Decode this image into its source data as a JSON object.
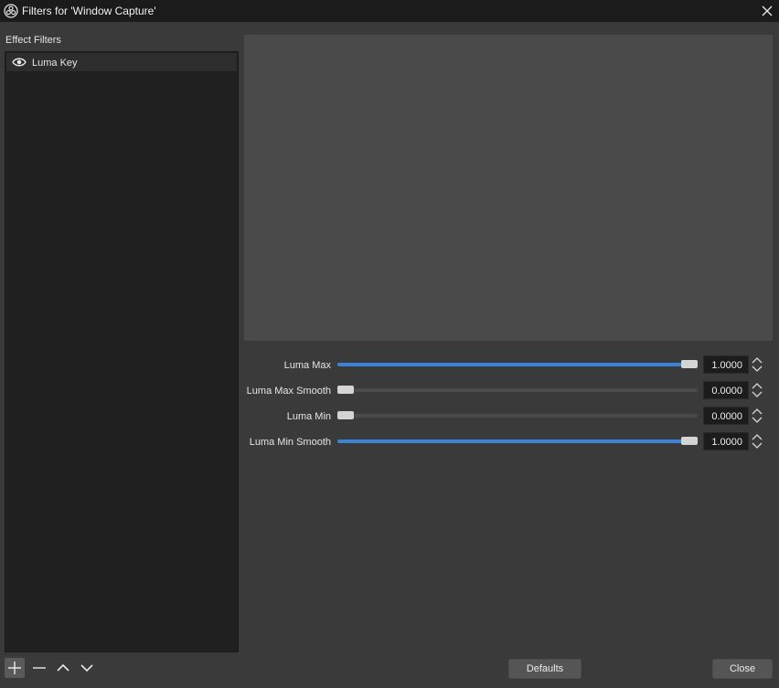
{
  "window": {
    "title": "Filters for 'Window Capture'",
    "title_icon": "obs-logo-icon",
    "close_icon": "close-icon"
  },
  "filters_panel": {
    "label": "Effect Filters",
    "items": [
      {
        "label": "Luma Key",
        "visible": true,
        "icon": "eye-icon"
      }
    ]
  },
  "properties": [
    {
      "label": "Luma Max",
      "value": "1.0000",
      "level": 1.0
    },
    {
      "label": "Luma Max Smooth",
      "value": "0.0000",
      "level": 0.0
    },
    {
      "label": "Luma Min",
      "value": "0.0000",
      "level": 0.0
    },
    {
      "label": "Luma Min Smooth",
      "value": "1.0000",
      "level": 1.0
    }
  ],
  "toolbar": {
    "add_icon": "plus-icon",
    "remove_icon": "minus-icon",
    "move_up_icon": "chevron-up-icon",
    "move_down_icon": "chevron-down-icon"
  },
  "buttons": {
    "defaults": "Defaults",
    "close": "Close"
  },
  "colors": {
    "accent": "#3b83d9",
    "background": "#3a3a3a",
    "titlebar": "#1b1b1b"
  }
}
